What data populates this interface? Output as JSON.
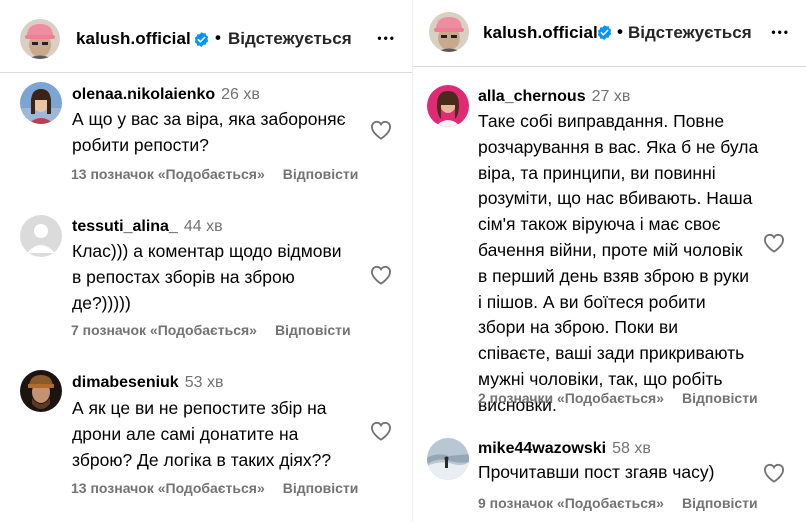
{
  "left": {
    "header": {
      "username": "kalush.official",
      "follow_status": "Відстежується",
      "more": "•••"
    },
    "comments": [
      {
        "username": "olenaa.nikolaienko",
        "time": "26 хв",
        "lines": [
          "А що у вас за віра, яка забороняє",
          "робити репости?"
        ],
        "likes": "13 позначок «Подобається»",
        "reply": "Відповісти"
      },
      {
        "username": "tessuti_alina_",
        "time": "44 хв",
        "lines": [
          "Клас))) а коментар щодо відмови",
          "в репостах зборів на зброю",
          "де?)))))"
        ],
        "likes": "7 позначок «Подобається»",
        "reply": "Відповісти"
      },
      {
        "username": "dimabeseniuk",
        "time": "53 хв",
        "lines": [
          "А як це ви не репостите збір на",
          "дрони але самі донатите на",
          "зброю? Де логіка в таких діях??"
        ],
        "likes": "13 позначок «Подобається»",
        "reply": "Відповісти"
      }
    ]
  },
  "right": {
    "header": {
      "username": "kalush.official",
      "follow_status": "Відстежується",
      "more": "•••"
    },
    "comments": [
      {
        "username": "alla_chernous",
        "time": "27 хв",
        "lines": [
          "Таке собі виправдання. Повне",
          "розчарування в вас. Яка б не була",
          "віра, та принципи, ви повинні",
          "розуміти, що нас вбивають. Наша",
          "сім'я також віруюча і має своє",
          "бачення війни, проте мій чоловік",
          "в перший день взяв зброю в руки",
          "і пішов. А ви боїтеся робити",
          "збори на зброю. Поки ви",
          "співаєте, ваші зади прикривають",
          "мужні чоловіки, так, що робіть",
          "висновки."
        ],
        "likes": "2 позначки «Подобається»",
        "reply": "Відповісти"
      },
      {
        "username": "mike44wazowski",
        "time": "58 хв",
        "lines": [
          "Прочитавши пост згаяв часу)"
        ],
        "likes": "9 позначок «Подобається»",
        "reply": "Відповісти"
      }
    ]
  },
  "colors": {
    "text": "#000000",
    "secondary": "#737373",
    "verified": "#0095f6",
    "divider": "#dbdbdb"
  },
  "icons": [
    "verified-badge-icon",
    "heart-outline-icon",
    "more-options-icon",
    "default-avatar-icon"
  ]
}
